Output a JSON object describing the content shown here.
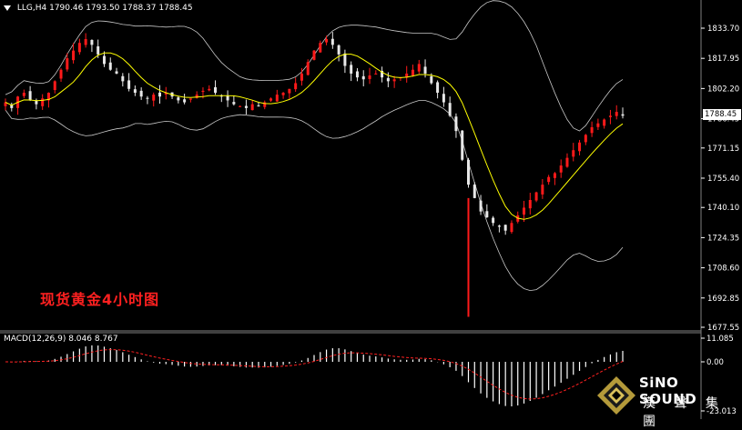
{
  "header": {
    "symbol": "LLG,H4",
    "ohlc": "1790.46 1793.50 1788.37 1788.45"
  },
  "chart_title": "现货黄金4小时图",
  "current_price": "1788.45",
  "macd_label": "MACD(12,26,9) 8.046 8.767",
  "logo": {
    "brand": "SiNO SOUND",
    "chinese": "漢 聲 集 團"
  },
  "colors": {
    "up": "#ff1a1a",
    "down": "#e8e8e8",
    "signal": "#ff2020",
    "ma": "#ffff00",
    "bands": "#c8c8c8",
    "axis": "#ffffff"
  },
  "chart_data": [
    {
      "type": "candlestick",
      "title": "现货黄金4小时图",
      "y_ticks": [
        "1833.70",
        "1817.95",
        "1802.20",
        "1786.45",
        "1771.15",
        "1755.40",
        "1740.10",
        "1724.35",
        "1708.60",
        "1692.85",
        "1677.55"
      ],
      "ylim": [
        1677.55,
        1843.0
      ],
      "close_series": [
        1795,
        1792,
        1798,
        1800,
        1796,
        1794,
        1797,
        1800,
        1806,
        1812,
        1818,
        1822,
        1826,
        1828,
        1825,
        1820,
        1815,
        1812,
        1810,
        1806,
        1802,
        1800,
        1798,
        1797,
        1799,
        1798,
        1800,
        1798,
        1796,
        1795,
        1797,
        1799,
        1801,
        1802,
        1800,
        1798,
        1796,
        1794,
        1793,
        1792,
        1794,
        1793,
        1795,
        1797,
        1799,
        1800,
        1802,
        1805,
        1810,
        1816,
        1822,
        1826,
        1828,
        1825,
        1820,
        1814,
        1810,
        1808,
        1807,
        1809,
        1810,
        1808,
        1806,
        1807,
        1808,
        1810,
        1812,
        1815,
        1810,
        1805,
        1800,
        1795,
        1788,
        1780,
        1765,
        1752,
        1745,
        1738,
        1735,
        1732,
        1730,
        1728,
        1732,
        1736,
        1740,
        1744,
        1748,
        1752,
        1756,
        1758,
        1762,
        1766,
        1770,
        1774,
        1778,
        1782,
        1784,
        1786,
        1788,
        1790,
        1788
      ],
      "ma_series": "moving average (yellow)",
      "bollinger": "upper / lower bands (grey)"
    },
    {
      "type": "bar",
      "title": "MACD(12,26,9) 8.046 8.767",
      "y_ticks": [
        "11.085",
        "0.00",
        "-23.013"
      ],
      "ylim": [
        -23.013,
        11.085
      ]
    }
  ]
}
